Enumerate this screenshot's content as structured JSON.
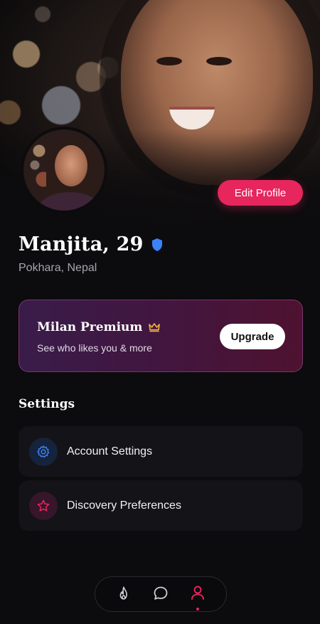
{
  "profile": {
    "name_age": "Manjita, 29",
    "location": "Pokhara, Nepal",
    "verified_icon": "shield-check-icon",
    "edit_label": "Edit Profile"
  },
  "premium": {
    "title": "Milan Premium",
    "subtitle": "See who likes you & more",
    "upgrade_label": "Upgrade",
    "icon": "crown-icon"
  },
  "settings": {
    "title": "Settings",
    "items": [
      {
        "label": "Account Settings",
        "icon": "gear-icon"
      },
      {
        "label": "Discovery Preferences",
        "icon": "star-icon"
      }
    ]
  },
  "nav": {
    "items": [
      {
        "icon": "flame-icon",
        "active": false
      },
      {
        "icon": "chat-icon",
        "active": false
      },
      {
        "icon": "user-icon",
        "active": true
      }
    ]
  },
  "colors": {
    "accent": "#e6265d",
    "verified": "#3b82f6",
    "crown": "#f5b13c",
    "background": "#0c0b0d",
    "card": "#141317"
  }
}
